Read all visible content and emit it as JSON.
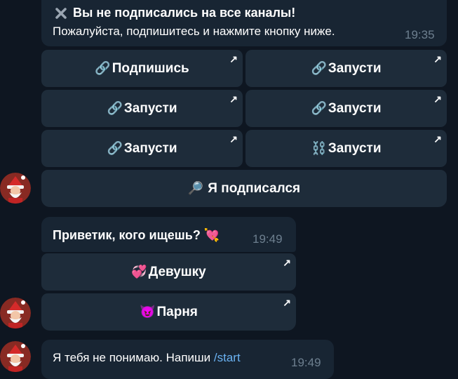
{
  "msg1": {
    "title_icon": "cross-icon",
    "title": "Вы не подписались на все каналы!",
    "text": "Пожалуйста, подпишитесь и нажмите кнопку ниже.",
    "time": "19:35",
    "buttons": [
      {
        "icon": "🔗",
        "label": "Подпишись"
      },
      {
        "icon": "🔗",
        "label": "Запусти"
      },
      {
        "icon": "🔗",
        "label": "Запусти"
      },
      {
        "icon": "🔗",
        "label": "Запусти"
      },
      {
        "icon": "🔗",
        "label": "Запусти"
      },
      {
        "icon": "⛓️",
        "label": "Запусти"
      }
    ],
    "confirm": {
      "icon": "🔎",
      "label": "Я подписался"
    }
  },
  "msg2": {
    "text": "Приветик, кого ищешь? 💘",
    "time": "19:49",
    "buttons": [
      {
        "icon": "💞",
        "label": "Девушку"
      },
      {
        "icon": "😈",
        "label": "Парня"
      }
    ]
  },
  "msg3": {
    "text": "Я тебя не понимаю. Напиши ",
    "link": "/start",
    "time": "19:49"
  },
  "arrow_glyph": "↗",
  "colors": {
    "background": "#0e1621",
    "bubble": "#182533",
    "button": "#1e2c3a",
    "timestamp": "#6d7f8f",
    "link": "#6ab2f2"
  }
}
